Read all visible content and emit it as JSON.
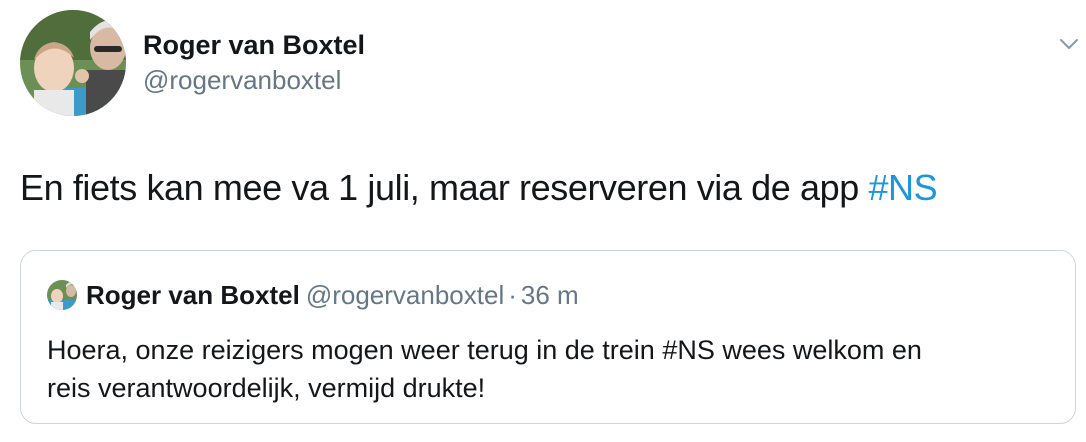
{
  "tweet": {
    "author_name": "Roger van Boxtel",
    "author_handle": "@rogervanboxtel",
    "text": "En fiets kan mee va 1 juli, maar reserveren via de app ",
    "hashtag": "#NS"
  },
  "quote": {
    "author_name": "Roger van Boxtel",
    "author_handle": "@rogervanboxtel",
    "separator": "·",
    "time": "36 m",
    "text_line1": "Hoera, onze reizigers mogen weer terug in de trein #NS wees welkom en",
    "text_line2": "reis verantwoordelijk, vermijd drukte!"
  },
  "icons": {
    "menu_caret": "chevron-down-icon"
  },
  "colors": {
    "primary_text": "#14171a",
    "secondary_text": "#657786",
    "link": "#1b95e0",
    "border": "#ccd6dd"
  }
}
